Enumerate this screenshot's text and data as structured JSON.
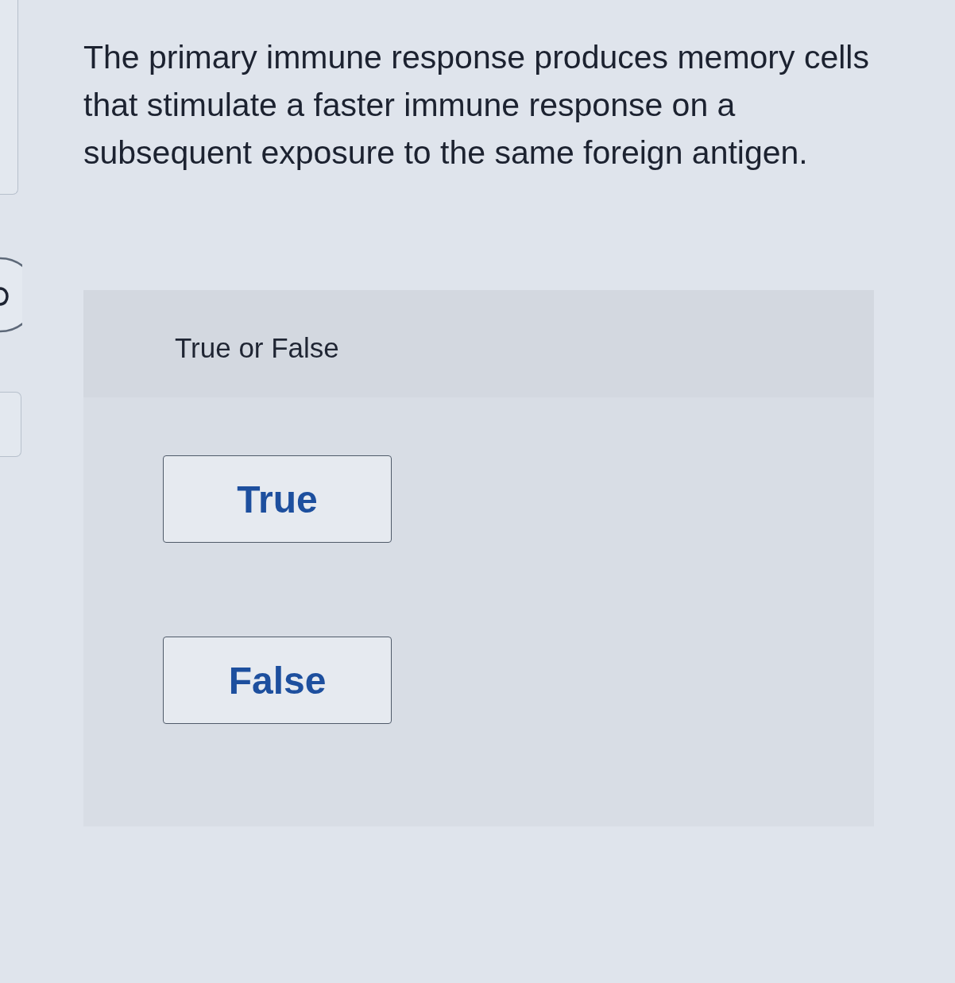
{
  "question": {
    "text": "The primary immune response produces memory cells that stimulate a faster immune response on a subsequent exposure to the same foreign antigen."
  },
  "answer_card": {
    "prompt": "True or False",
    "options": [
      {
        "label": "True",
        "selected": false
      },
      {
        "label": "False",
        "selected": false
      }
    ]
  }
}
